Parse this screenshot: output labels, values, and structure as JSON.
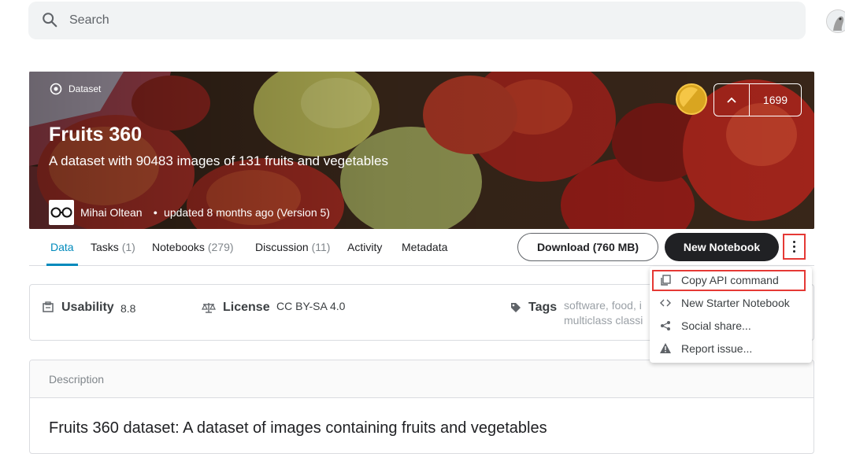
{
  "search": {
    "placeholder": "Search"
  },
  "hero": {
    "type_label": "Dataset",
    "title": "Fruits 360",
    "subtitle": "A dataset with 90483 images of 131 fruits and vegetables",
    "owner": "Mihai Oltean",
    "updated": "updated 8 months ago (Version 5)",
    "votes": "1699"
  },
  "tabs": [
    {
      "label": "Data",
      "count": ""
    },
    {
      "label": "Tasks",
      "count": "(1)"
    },
    {
      "label": "Notebooks",
      "count": "(279)"
    },
    {
      "label": "Discussion",
      "count": "(11)"
    },
    {
      "label": "Activity",
      "count": ""
    },
    {
      "label": "Metadata",
      "count": ""
    }
  ],
  "actions": {
    "download": "Download (760 MB)",
    "new_notebook": "New Notebook"
  },
  "info": {
    "usability_label": "Usability",
    "usability_value": "8.8",
    "license_label": "License",
    "license_value": "CC BY-SA 4.0",
    "tags_label": "Tags",
    "tags_line1": "software, food, i",
    "tags_line2": "multiclass classi"
  },
  "description": {
    "header": "Description",
    "heading": "Fruits 360 dataset: A dataset of images containing fruits and vegetables"
  },
  "menu": {
    "items": [
      {
        "label": "Copy API command",
        "icon": "copy-icon"
      },
      {
        "label": "New Starter Notebook",
        "icon": "code-icon"
      },
      {
        "label": "Social share...",
        "icon": "share-icon"
      },
      {
        "label": "Report issue...",
        "icon": "warning-icon"
      }
    ]
  },
  "colors": {
    "accent": "#008abc",
    "highlight": "#e53935",
    "dark_button": "#202124"
  }
}
